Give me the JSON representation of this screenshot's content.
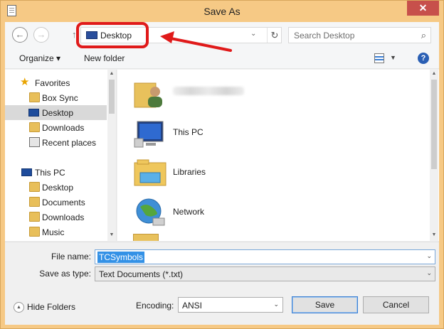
{
  "window": {
    "title": "Save As",
    "close_glyph": "✕"
  },
  "nav": {
    "back_glyph": "←",
    "forward_glyph": "→",
    "up_glyph": "↑",
    "address_crumb": "Desktop",
    "dropdown_glyph": "⌄",
    "refresh_glyph": "↻",
    "search_placeholder": "Search Desktop",
    "search_glyph": "⌕"
  },
  "toolbar": {
    "organize_label": "Organize ▾",
    "new_folder_label": "New folder",
    "view_dropdown_glyph": "▼",
    "help_glyph": "?"
  },
  "sidebar": {
    "items": [
      {
        "label": "Favorites",
        "icon": "star-icon"
      },
      {
        "label": "Box Sync",
        "icon": "folder-icon"
      },
      {
        "label": "Desktop",
        "icon": "desktop-icon",
        "selected": true
      },
      {
        "label": "Downloads",
        "icon": "downloads-folder-icon"
      },
      {
        "label": "Recent places",
        "icon": "recent-places-icon"
      },
      {
        "label": "This PC",
        "icon": "computer-icon"
      },
      {
        "label": "Desktop",
        "icon": "folder-icon"
      },
      {
        "label": "Documents",
        "icon": "documents-folder-icon"
      },
      {
        "label": "Downloads",
        "icon": "downloads-folder-icon"
      },
      {
        "label": "Music",
        "icon": "music-folder-icon"
      }
    ],
    "scroll_up_glyph": "▲",
    "scroll_down_glyph": "▼"
  },
  "files": {
    "items": [
      {
        "label": "",
        "icon": "user-folder-icon",
        "blurred": true
      },
      {
        "label": "This PC",
        "icon": "computer-icon"
      },
      {
        "label": "Libraries",
        "icon": "libraries-icon"
      },
      {
        "label": "Network",
        "icon": "network-icon"
      }
    ],
    "scroll_up_glyph": "▲",
    "scroll_down_glyph": "▼"
  },
  "form": {
    "filename_label": "File name:",
    "filename_value": "TCSymbols",
    "savetype_label": "Save as type:",
    "savetype_value": "Text Documents (*.txt)",
    "dropdown_glyph": "⌄",
    "encoding_label": "Encoding:",
    "encoding_value": "ANSI",
    "hide_folders_label": "Hide Folders",
    "hide_folders_glyph": "▲",
    "save_label": "Save",
    "cancel_label": "Cancel"
  },
  "annotation": {
    "highlight_color": "#e01a1a"
  },
  "colors": {
    "title_bg": "#f6c985",
    "accent": "#3391e6",
    "close_button": "#c7504b"
  }
}
